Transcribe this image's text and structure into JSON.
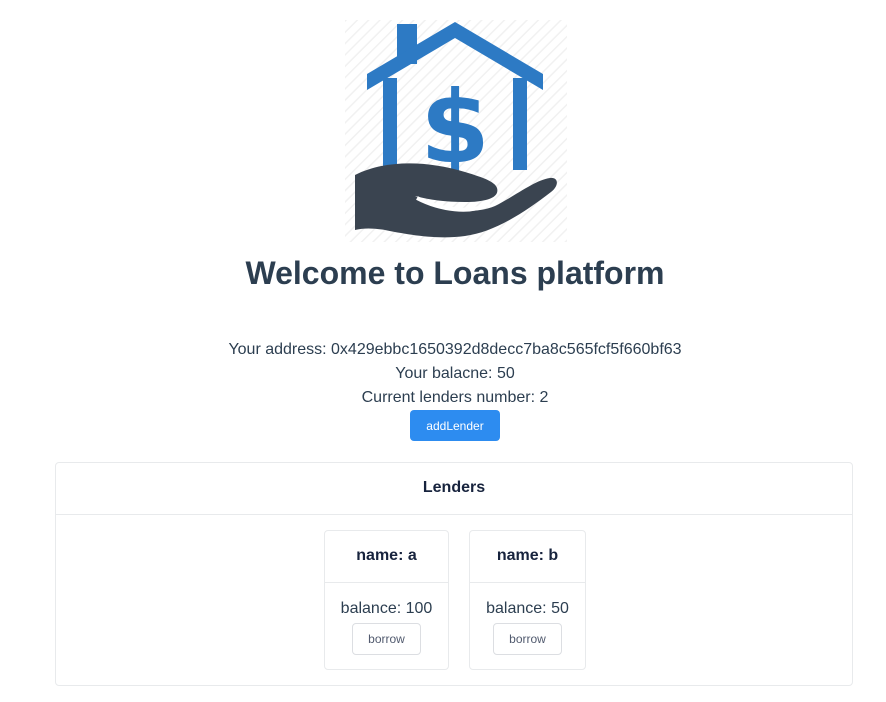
{
  "logo": {
    "icon": "house-dollar-hand-icon",
    "colors": {
      "house": "#2d7ac4",
      "hand": "#3a4450"
    }
  },
  "header": {
    "title": "Welcome to Loans platform"
  },
  "account": {
    "address_text": "Your address: 0x429ebbc1650392d8decc7ba8c565fcf5f660bf63",
    "balance_text": "Your balacne: 50",
    "lenders_count_text": "Current lenders number: 2"
  },
  "actions": {
    "add_lender_label": "addLender"
  },
  "lenders_panel": {
    "title": "Lenders",
    "items": [
      {
        "name_text": "name: a",
        "balance_text": "balance: 100",
        "borrow_label": "borrow"
      },
      {
        "name_text": "name: b",
        "balance_text": "balance: 50",
        "borrow_label": "borrow"
      }
    ]
  },
  "colors": {
    "primary": "#2d8cf0",
    "text": "#2c3e50",
    "border": "#e8eaec"
  }
}
